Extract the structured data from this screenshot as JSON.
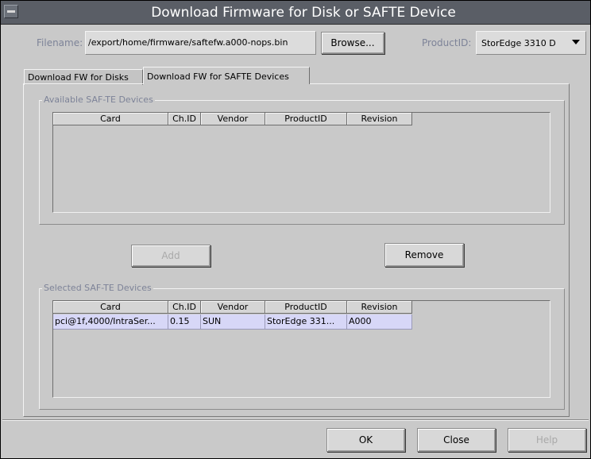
{
  "window": {
    "title": "Download Firmware for Disk or SAFTE Device"
  },
  "file": {
    "filename_label": "Filename:",
    "filename_value": "/export/home/firmware/saftefw.a000-nops.bin",
    "browse_label": "Browse..."
  },
  "product": {
    "label": "ProductID:",
    "value": "StorEdge 3310 D"
  },
  "tabs": [
    {
      "label": "Download FW for Disks"
    },
    {
      "label": "Download FW for SAFTE Devices"
    }
  ],
  "available": {
    "title": "Available SAF-TE Devices",
    "columns": [
      "Card",
      "Ch.ID",
      "Vendor",
      "ProductID",
      "Revision"
    ],
    "rows": []
  },
  "actions": {
    "add_label": "Add",
    "remove_label": "Remove"
  },
  "selected": {
    "title": "Selected SAF-TE Devices",
    "columns": [
      "Card",
      "Ch.ID",
      "Vendor",
      "ProductID",
      "Revision"
    ],
    "rows": [
      [
        "pci@1f,4000/IntraSer...",
        "0.15",
        "SUN",
        "StorEdge 331...",
        "A000"
      ]
    ]
  },
  "footer": {
    "ok_label": "OK",
    "close_label": "Close",
    "help_label": "Help"
  }
}
